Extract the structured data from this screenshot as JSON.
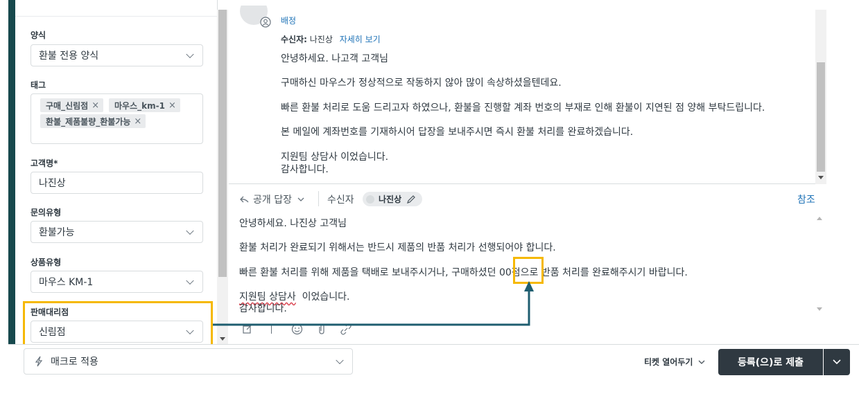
{
  "sidebar_fields": {
    "form_label": "양식",
    "form_value": "환불 전용 양식",
    "tags_label": "태그",
    "tags": [
      "구매_신림점",
      "마우스_km-1",
      "환불_제품불량_환불가능"
    ],
    "customer_label": "고객명*",
    "customer_value": "나진상",
    "inquiry_label": "문의유형",
    "inquiry_value": "환불가능",
    "product_label": "상품유형",
    "product_value": "마우스 KM-1",
    "dealer_label": "판매대리점",
    "dealer_value": "신림점"
  },
  "conversation": {
    "assign_link": "배정",
    "recipient_label": "수신자:",
    "recipient_name": "나진상",
    "details_link": "자세히 보기",
    "lines": [
      "안녕하세요. 나고객 고객님",
      "구매하신 마우스가 정상적으로 작동하지 않아 많이 속상하셨을텐데요.",
      "빠른 환불 처리로 도움 드리고자 하였으나, 환불을 진행할 계좌 번호의 부재로 인해 환불이 지연된 점 양해 부탁드립니다.",
      "본 메일에 계좌번호를 기재하시어 답장을 보내주시면 즉시 환불 처리를 완료하겠습니다.",
      "지원팀 상담사  이었습니다.",
      "감사합니다."
    ]
  },
  "reply": {
    "mode_label": "공개 답장",
    "recipient_label": "수신자",
    "recipient_chip": "나진상",
    "cc_link": "참조",
    "line1": "안녕하세요. 나진상 고객님",
    "line2": "환불 처리가 완료되기 위해서는 반드시 제품의 반품 처리가 선행되어야 합니다.",
    "line3_pre": "빠른 환불 처리를 위해 제품을 택배로 보내주시거나, 구매하셨던 ",
    "line3_placeholder": "00점",
    "line3_post": "으로 반품 처리를 완료해주시기 바랍니다.",
    "line4_pre": "지원팀 상담사",
    "line4_post": "  이었습니다.",
    "line5": "감사합니다."
  },
  "footer": {
    "macro_label": "매크로 적용",
    "ticket_status_label": "티켓 열어두기",
    "submit_label": "등록(으)로 제출"
  },
  "colors": {
    "highlight": "#f5b800",
    "arrow": "#1f5e70",
    "submit_bg": "#2f3941",
    "link": "#1f73b7"
  }
}
